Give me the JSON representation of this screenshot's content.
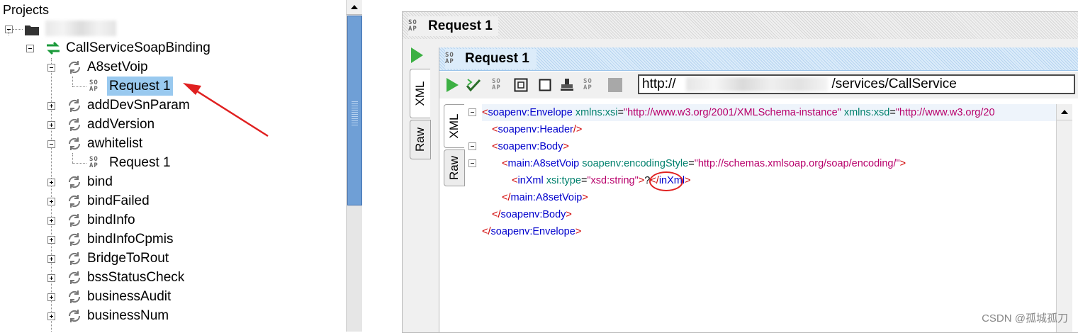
{
  "tree": {
    "title": "Projects",
    "binding": "CallServiceSoapBinding",
    "operations": [
      {
        "name": "A8setVoip",
        "expanded": true,
        "request": "Request 1"
      },
      {
        "name": "addDevSnParam",
        "expanded": false
      },
      {
        "name": "addVersion",
        "expanded": false
      },
      {
        "name": "awhitelist",
        "expanded": true,
        "request": "Request 1"
      },
      {
        "name": "bind",
        "expanded": false
      },
      {
        "name": "bindFailed",
        "expanded": false
      },
      {
        "name": "bindInfo",
        "expanded": false
      },
      {
        "name": "bindInfoCpmis",
        "expanded": false
      },
      {
        "name": "BridgeToRout",
        "expanded": false
      },
      {
        "name": "bssStatusCheck",
        "expanded": false
      },
      {
        "name": "businessAudit",
        "expanded": false
      },
      {
        "name": "businessNum",
        "expanded": false
      }
    ]
  },
  "request_panel": {
    "outer_title": "Request 1",
    "inner_title": "Request 1",
    "outer_tabs": [
      "XML",
      "Raw"
    ],
    "inner_tabs": [
      "XML",
      "Raw"
    ],
    "endpoint_prefix": "http://",
    "endpoint_suffix": "/services/CallService",
    "soap_icon_text": "SO AP"
  },
  "xml": {
    "l1": {
      "b1": "<",
      "tag": "soapenv:Envelope",
      "a1": "xmlns:xsi",
      "eq1": "=",
      "v1": "\"http://www.w3.org/2001/XMLSchema-instance\"",
      "a2": "xmlns:xsd",
      "eq2": "=",
      "v2": "\"http://www.w3.org/20"
    },
    "l2": {
      "b1": "<",
      "tag": "soapenv:Header",
      "b2": "/>"
    },
    "l3": {
      "b1": "<",
      "tag": "soapenv:Body",
      "b2": ">"
    },
    "l4": {
      "b1": "<",
      "tag": "main:A8setVoip",
      "a1": "soapenv:encodingStyle",
      "eq1": "=",
      "v1": "\"http://schemas.xmlsoap.org/soap/encoding/\"",
      "b2": ">"
    },
    "l5": {
      "b1": "<",
      "tag": "inXml",
      "a1": "xsi:type",
      "eq1": "=",
      "v1": "\"xsd:string\"",
      "b2": ">",
      "text": "?",
      "b3": "</",
      "tag2": "inXml",
      "b4": ">"
    },
    "l6": {
      "b1": "</",
      "tag": "main:A8setVoip",
      "b2": ">"
    },
    "l7": {
      "b1": "</",
      "tag": "soapenv:Body",
      "b2": ">"
    },
    "l8": {
      "b1": "</",
      "tag": "soapenv:Envelope",
      "b2": ">"
    }
  },
  "watermark": "CSDN @孤城孤刀",
  "colors": {
    "selection": "#99c9ef",
    "run_green": "#3cb043",
    "annotation_red": "#e02020",
    "scroll_thumb": "#6f9fd6"
  }
}
